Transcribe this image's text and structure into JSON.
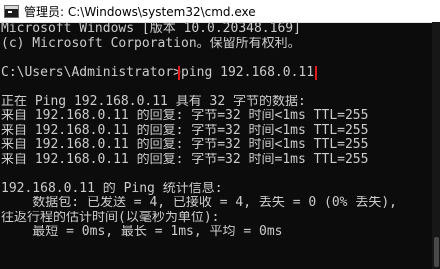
{
  "window": {
    "title": "管理员: C:\\Windows\\system32\\cmd.exe"
  },
  "console": {
    "lines": [
      "Microsoft Windows [版本 10.0.20348.169]",
      "(c) Microsoft Corporation。保留所有权利。",
      "",
      "",
      "",
      "正在 Ping 192.168.0.11 具有 32 字节的数据:",
      "来自 192.168.0.11 的回复: 字节=32 时间<1ms TTL=255",
      "来自 192.168.0.11 的回复: 字节=32 时间<1ms TTL=255",
      "来自 192.168.0.11 的回复: 字节=32 时间<1ms TTL=255",
      "来自 192.168.0.11 的回复: 字节=32 时间=1ms TTL=255",
      "",
      "192.168.0.11 的 Ping 统计信息:",
      "    数据包: 已发送 = 4, 已接收 = 4, 丢失 = 0 (0% 丢失),",
      "往返行程的估计时间(以毫秒为单位):",
      "    最短 = 0ms, 最长 = 1ms, 平均 = 0ms"
    ],
    "prompt": "C:\\Users\\Administrator>",
    "command": "ping 192.168.0.11"
  },
  "colors": {
    "background": "#0c0c0c",
    "text": "#cccccc",
    "highlight_box": "#e0191a"
  }
}
